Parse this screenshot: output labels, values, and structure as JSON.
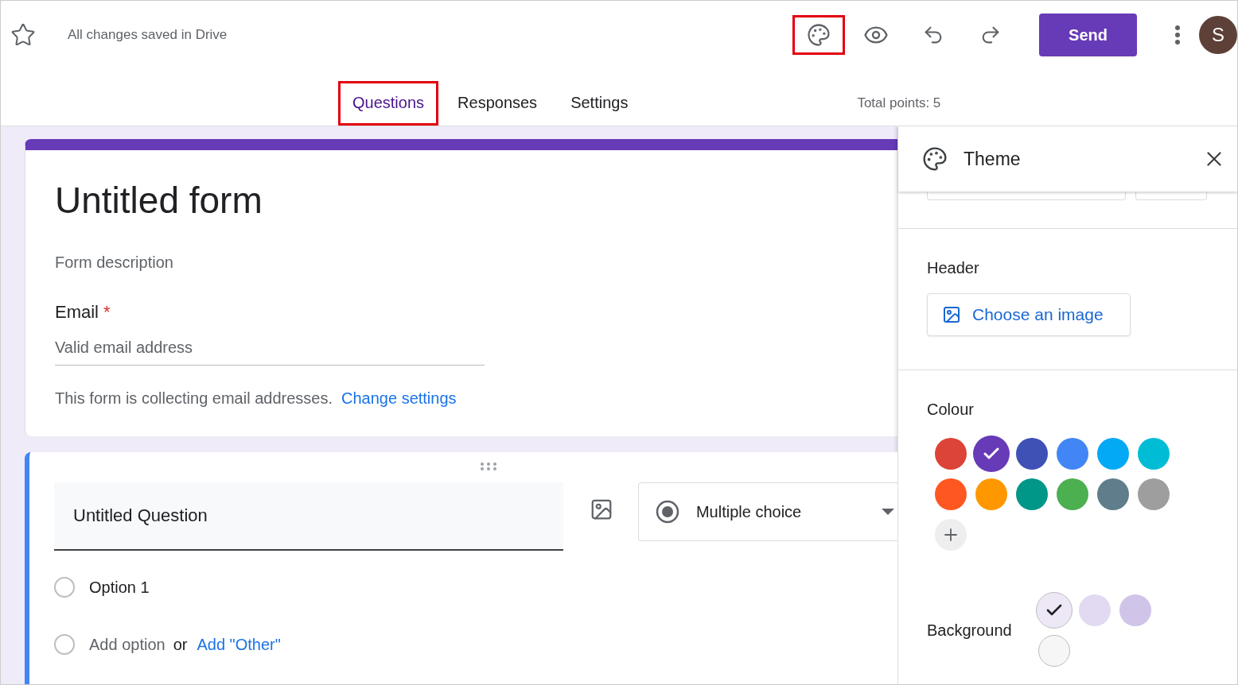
{
  "header": {
    "saved_status": "All changes saved in Drive",
    "toolbar": [
      {
        "kind": "palette",
        "highlighted": true
      },
      {
        "kind": "preview",
        "highlighted": false
      },
      {
        "kind": "undo",
        "highlighted": false
      },
      {
        "kind": "redo",
        "highlighted": false
      }
    ],
    "send_button": "Send",
    "avatar": "S"
  },
  "tabs": [
    {
      "label": "Questions",
      "selected": true,
      "highlighted": true
    },
    {
      "label": "Responses",
      "selected": false,
      "highlighted": false
    },
    {
      "label": "Settings",
      "selected": false,
      "highlighted": false
    }
  ],
  "total_points": "Total points: 5",
  "form": {
    "title": "Untitled form",
    "description_placeholder": "Form description",
    "email": {
      "label": "Email",
      "required": true,
      "required_mark": "*",
      "placeholder": "Valid email address"
    },
    "notice": "This form is collecting email addresses.",
    "notice_link": "Change settings"
  },
  "question": {
    "title": "Untitled Question",
    "type": "Multiple choice",
    "options": [
      {
        "label": "Option 1",
        "checked": false
      }
    ],
    "add_option_checked": false,
    "add_option": "Add option",
    "or": "or",
    "add_other": "Add \"Other\""
  },
  "theme_panel": {
    "title": "Theme",
    "header_label": "Header",
    "choose_image": "Choose an image",
    "colour_label": "Colour",
    "colours": [
      {
        "color": "#db4437",
        "selected": false
      },
      {
        "color": "#673ab7",
        "selected": true
      },
      {
        "color": "#3f51b5",
        "selected": false
      },
      {
        "color": "#4285f4",
        "selected": false
      },
      {
        "color": "#03a9f4",
        "selected": false
      },
      {
        "color": "#00bcd4",
        "selected": false
      },
      {
        "color": "#ff5722",
        "selected": false
      },
      {
        "color": "#ff9800",
        "selected": false
      },
      {
        "color": "#009688",
        "selected": false
      },
      {
        "color": "#4caf50",
        "selected": false
      },
      {
        "color": "#607d8b",
        "selected": false
      },
      {
        "color": "#9e9e9e",
        "selected": false
      }
    ],
    "background_label": "Background",
    "backgrounds": [
      {
        "color": "#ede7f6",
        "selected": true
      },
      {
        "color": "#e1daf2",
        "selected": false
      },
      {
        "color": "#d1c4e9",
        "selected": false
      },
      {
        "color": "#f6f6f6",
        "selected": false
      }
    ]
  }
}
